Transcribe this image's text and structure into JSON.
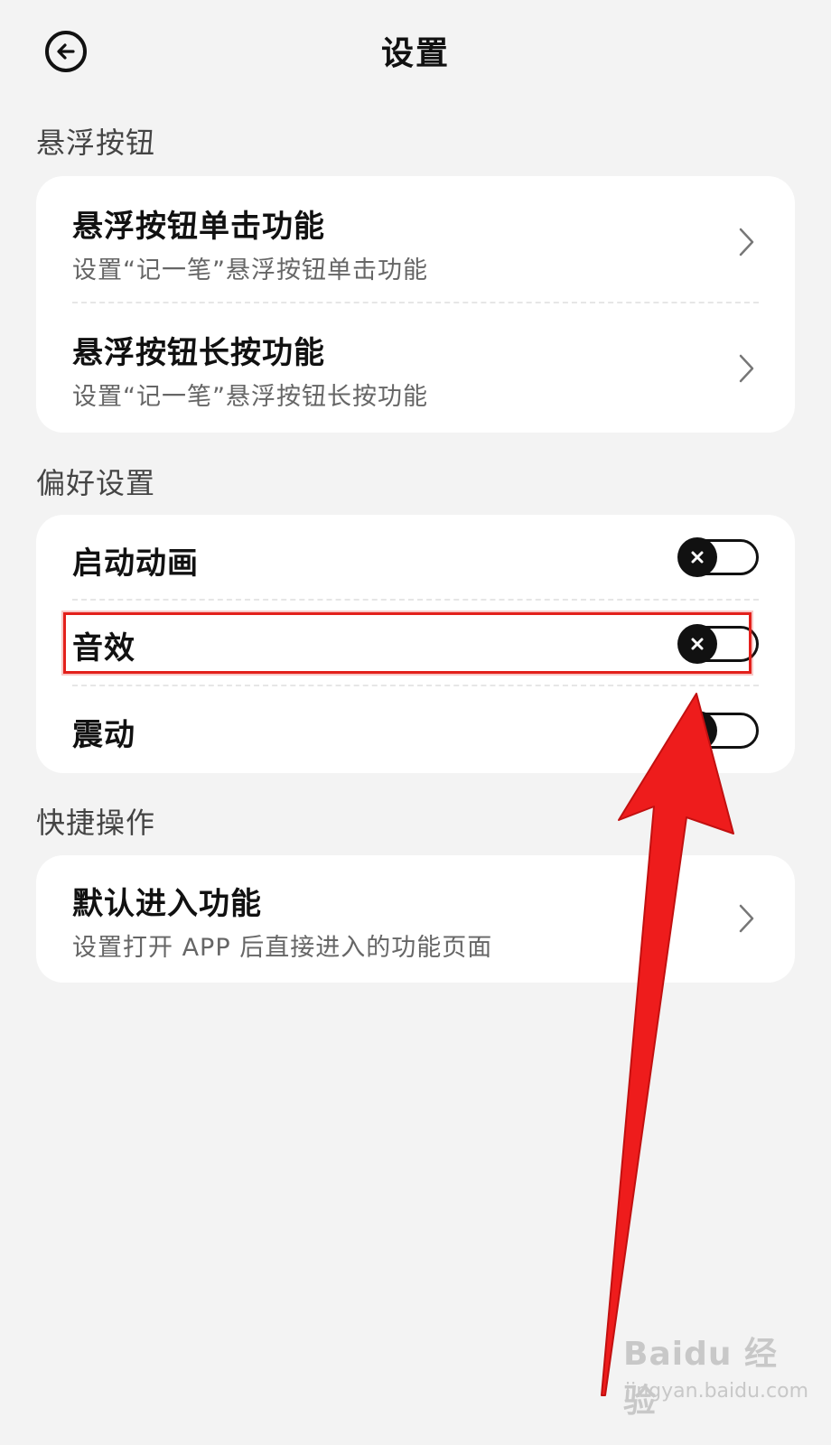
{
  "header": {
    "title": "设置",
    "back_icon": "back-arrow-circle-icon"
  },
  "sections": {
    "floating": {
      "title": "悬浮按钮",
      "items": [
        {
          "title": "悬浮按钮单击功能",
          "subtitle": "设置“记一笔”悬浮按钮单击功能"
        },
        {
          "title": "悬浮按钮长按功能",
          "subtitle": "设置“记一笔”悬浮按钮长按功能"
        }
      ]
    },
    "preferences": {
      "title": "偏好设置",
      "items": [
        {
          "title": "启动动画",
          "toggle": "off"
        },
        {
          "title": "音效",
          "toggle": "off"
        },
        {
          "title": "震动",
          "toggle": "off"
        }
      ]
    },
    "shortcuts": {
      "title": "快捷操作",
      "items": [
        {
          "title": "默认进入功能",
          "subtitle": "设置打开 APP 后直接进入的功能页面"
        }
      ]
    }
  },
  "annotation": {
    "highlight_color": "#e3201b",
    "arrow_color": "#ee1c1c"
  },
  "watermark": {
    "logo": "Baidu 经验",
    "url": "jingyan.baidu.com"
  }
}
